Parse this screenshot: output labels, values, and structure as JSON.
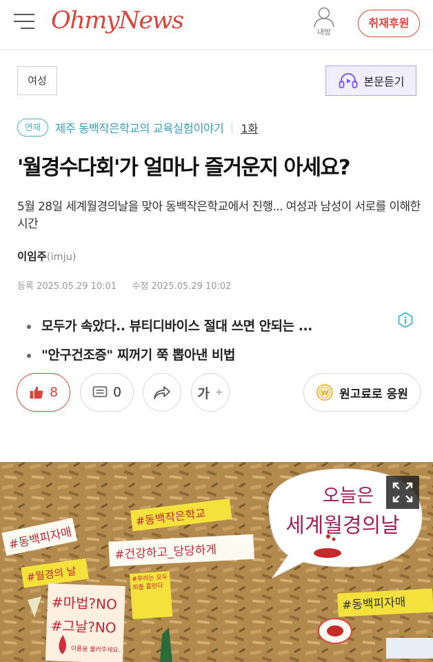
{
  "header": {
    "logo": "OhmyNews",
    "user_label": "내방",
    "donate_label": "취재후원"
  },
  "article": {
    "category": "여성",
    "listen_label": "본문듣기",
    "series_badge": "연재",
    "series_title": "제주 동백작은학교의 교육실험이야기",
    "episode": "1화",
    "title": "'월경수다회'가 얼마나 즐거운지 아세요?",
    "subtitle": "5월 28일 세계월경의날을 맞아 동백작은학교에서 진행... 여성과 남성이 서로를 이해한 시간",
    "author_name": "이임주",
    "author_id": "(imju)",
    "registered_label": "등록",
    "registered_date": "2025.05.29 10:01",
    "modified_label": "수정",
    "modified_date": "2025.05.29 10:02"
  },
  "related": [
    "모두가 속았다.. 뷰티디바이스 절대 쓰면 안되는 ...",
    "\"안구건조증\" 찌꺼기 쭉 뽑아낸 비법"
  ],
  "actions": {
    "like_count": "8",
    "comment_count": "0",
    "font_label": "가",
    "font_plus": "+",
    "support_label": "원고료로 응원"
  },
  "photo": {
    "bubble_line1": "오늘은",
    "bubble_line2": "세계월경의날",
    "signs": [
      "#동백피자매",
      "#동백작은학교",
      "#건강하고_당당하게",
      "#월경의 날",
      "#우리는 모두 피를 흘린다",
      "#마법?NO",
      "#그날?NO",
      "이름을 불러주세요.",
      "#동백피자매"
    ]
  },
  "colors": {
    "brand_red": "#d9453b",
    "series_teal": "#37a0b8",
    "listen_bg": "#f1eeff"
  }
}
